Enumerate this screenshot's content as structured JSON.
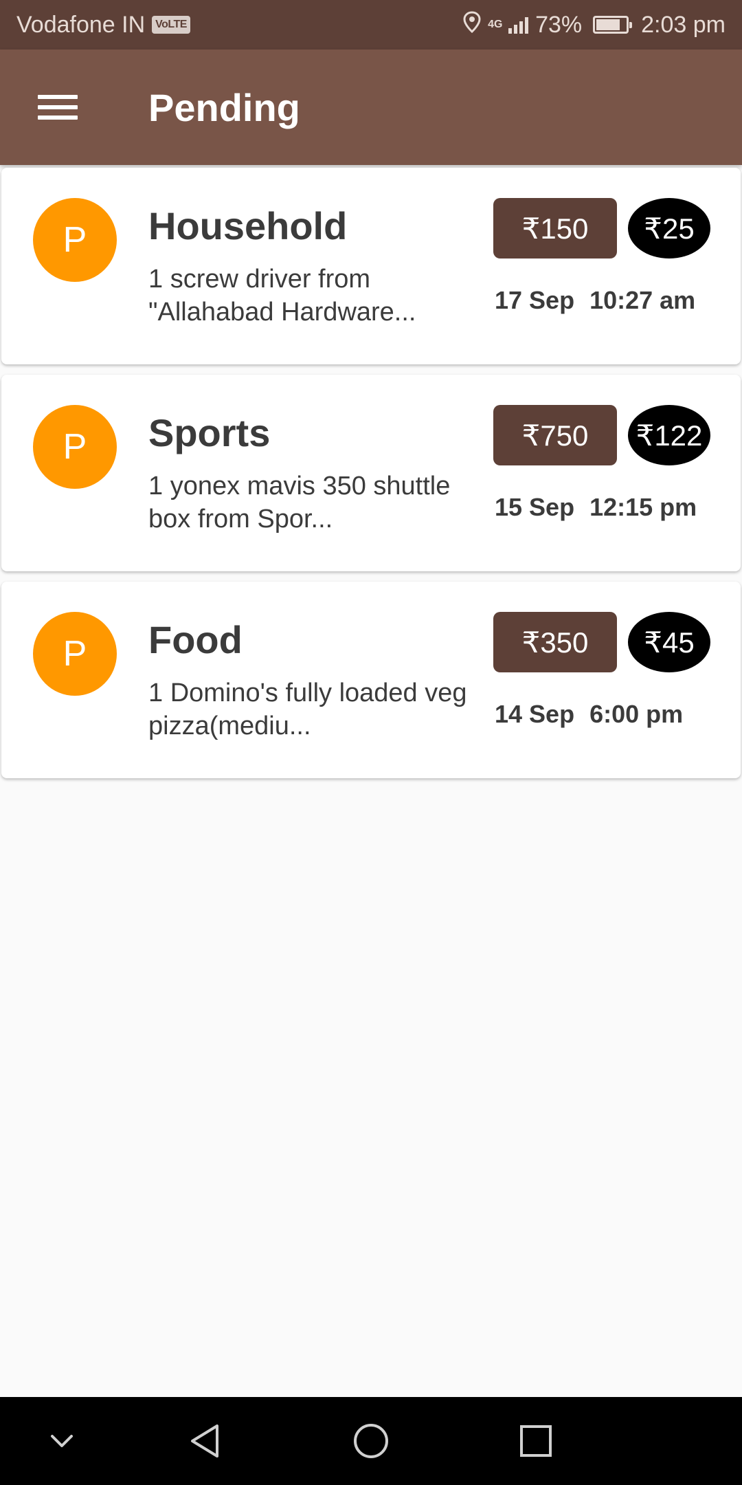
{
  "status_bar": {
    "carrier": "Vodafone IN",
    "volte": "VoLTE",
    "network": "4G",
    "battery_percent": "73%",
    "battery_level": 0.73,
    "time": "2:03 pm"
  },
  "app_bar": {
    "title": "Pending",
    "menu_icon": "hamburger-menu-icon"
  },
  "orders": [
    {
      "avatar_letter": "P",
      "category": "Household",
      "description": "1 screw driver from \"Allahabad Hardware...",
      "price": "₹150",
      "tip": "₹25",
      "date": "17 Sep",
      "time": "10:27 am"
    },
    {
      "avatar_letter": "P",
      "category": "Sports",
      "description": "1 yonex mavis 350 shuttle box from Spor...",
      "price": "₹750",
      "tip": "₹122",
      "date": "15 Sep",
      "time": "12:15 pm"
    },
    {
      "avatar_letter": "P",
      "category": "Food",
      "description": "1 Domino's fully loaded veg pizza(mediu...",
      "price": "₹350",
      "tip": "₹45",
      "date": "14 Sep",
      "time": "6:00 pm"
    }
  ],
  "colors": {
    "status_bar": "#5d4037",
    "app_bar": "#795548",
    "avatar": "#ff9800",
    "price_badge": "#5d4037",
    "tip_badge": "#000000"
  },
  "nav_bar": {
    "icons": [
      "chevron-down-icon",
      "back-icon",
      "home-icon",
      "recents-icon"
    ]
  }
}
